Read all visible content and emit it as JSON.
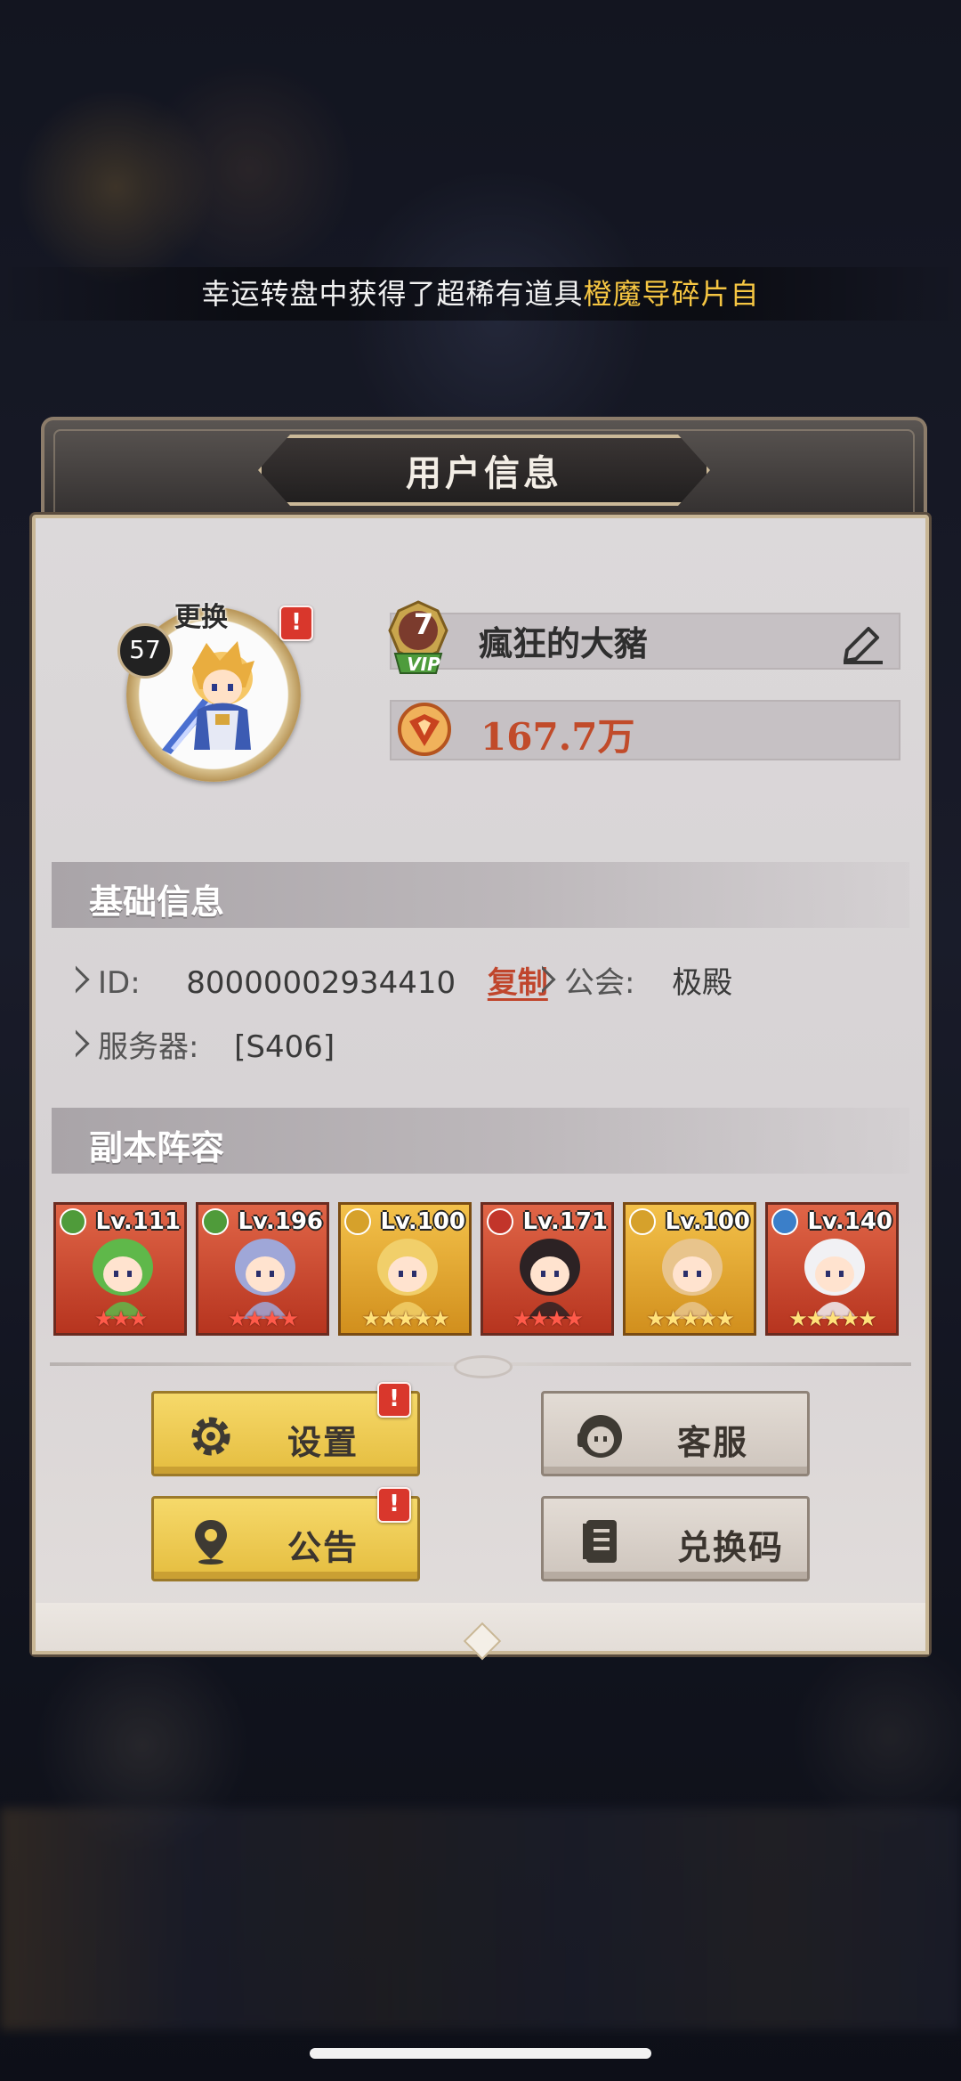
{
  "ticker": {
    "prefix": "幸运转盘中获得了超稀有道具",
    "highlight": "橙魔导碎片自"
  },
  "panel": {
    "title": "用户信息"
  },
  "profile": {
    "avatar_label": "更换",
    "level": "57",
    "vip": "7",
    "vip_label": "VIP",
    "name": "瘋狂的大豬",
    "power": "167.7万"
  },
  "basic_info": {
    "header": "基础信息",
    "id_label": "ID:",
    "id_value": "80000002934410",
    "copy_label": "复制",
    "guild_label": "公会:",
    "guild_value": "极殿",
    "server_label": "服务器:",
    "server_value": "[S406]"
  },
  "lineup": {
    "header": "副本阵容",
    "heroes": [
      {
        "level": "Lv.111",
        "element": "nature",
        "stars": 3,
        "frame": "red"
      },
      {
        "level": "Lv.196",
        "element": "nature",
        "stars": 4,
        "frame": "red"
      },
      {
        "level": "Lv.100",
        "element": "light",
        "stars": 5,
        "frame": "gold"
      },
      {
        "level": "Lv.171",
        "element": "fire",
        "stars": 4,
        "frame": "red"
      },
      {
        "level": "Lv.100",
        "element": "light",
        "stars": 5,
        "frame": "gold"
      },
      {
        "level": "Lv.140",
        "element": "water",
        "stars": 5,
        "frame": "red"
      }
    ]
  },
  "buttons": {
    "settings": "设置",
    "support": "客服",
    "notice": "公告",
    "redeem": "兑换码"
  },
  "alert_mark": "!",
  "colors": {
    "accent_red": "#c14b2a",
    "button_yellow": "#f0cd56",
    "ticker_highlight": "#f5c542"
  },
  "icons": [
    "edit-icon",
    "gear-icon",
    "headset-icon",
    "map-pin-icon",
    "book-icon",
    "power-icon"
  ]
}
